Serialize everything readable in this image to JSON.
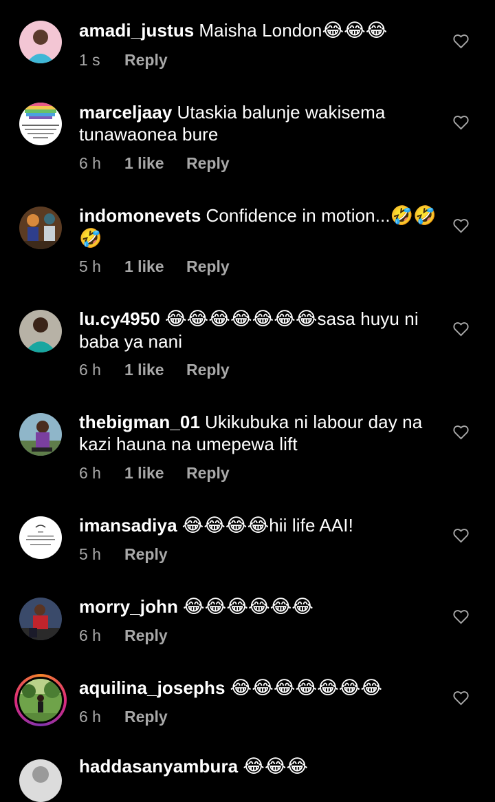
{
  "comments": [
    {
      "username": "amadi_justus",
      "text": "Maisha London",
      "emoji": "😂😂😂",
      "time": "1 s",
      "likes": "",
      "reply": "Reply"
    },
    {
      "username": "marceljaay",
      "text": "Utaskia balunje wakisema tunawaonea  bure",
      "emoji": "",
      "time": "6 h",
      "likes": "1 like",
      "reply": "Reply"
    },
    {
      "username": "indomonevets",
      "text": "Confidence in motion...",
      "emoji": "🤣🤣🤣",
      "time": "5 h",
      "likes": "1 like",
      "reply": "Reply"
    },
    {
      "username": "lu.cy4950",
      "text": "sasa huyu ni baba ya nani",
      "emoji": "😂😂😂😂😂😂😂",
      "time": "6 h",
      "likes": "1 like",
      "reply": "Reply"
    },
    {
      "username": "thebigman_01",
      "text": "Ukikubuka ni labour day na kazi hauna na umepewa lift",
      "emoji": "",
      "time": "6 h",
      "likes": "1 like",
      "reply": "Reply"
    },
    {
      "username": "imansadiya",
      "text": "hii life AAI!",
      "emoji": "😂😂😂😂",
      "time": "5 h",
      "likes": "",
      "reply": "Reply"
    },
    {
      "username": "morry_john",
      "text": "",
      "emoji": "😂😂😂😂😂😂",
      "time": "6 h",
      "likes": "",
      "reply": "Reply"
    },
    {
      "username": "aquilina_josephs",
      "text": "",
      "emoji": "😂😂😂😂😂😂😂",
      "time": "6 h",
      "likes": "",
      "reply": "Reply"
    },
    {
      "username": "haddasanyambura",
      "text": "",
      "emoji": "😂😂😂",
      "time": "",
      "likes": "",
      "reply": ""
    }
  ],
  "colors": {
    "background": "#000000",
    "text": "#ffffff",
    "meta": "#a8a8a8",
    "story_ring_start": "#f58529",
    "story_ring_end": "#dd2a7b"
  },
  "icons": {
    "like": "heart-outline-icon"
  }
}
